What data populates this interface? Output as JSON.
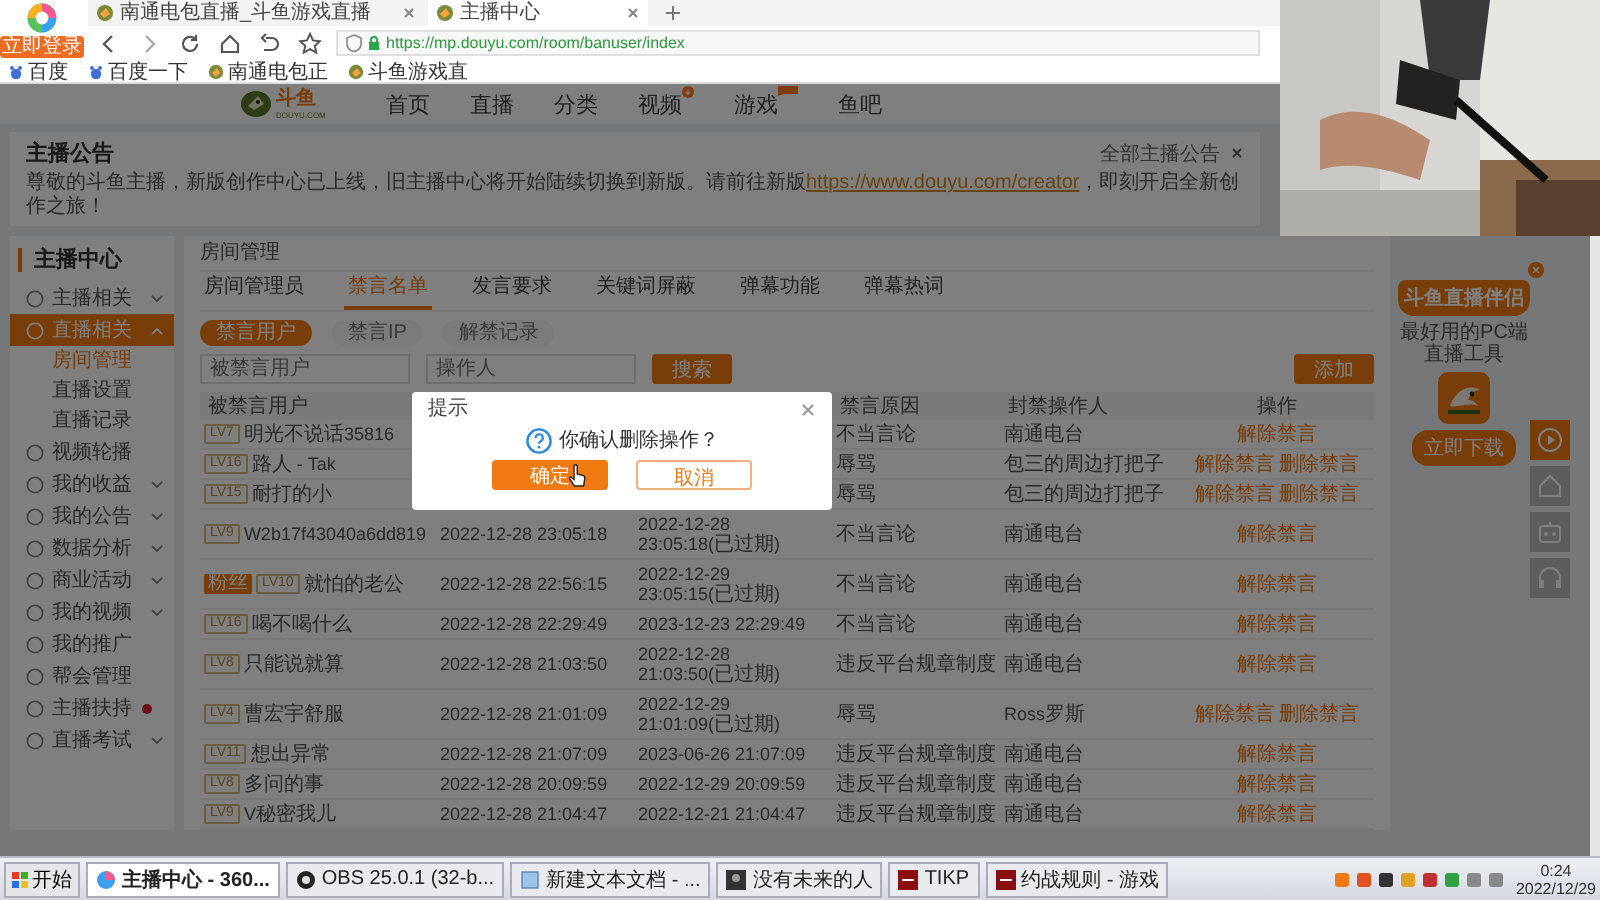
{
  "browser": {
    "login_badge": "立即登录",
    "tabs": [
      {
        "title": "南通电包直播_斗鱼游戏直播",
        "selected": false
      },
      {
        "title": "主播中心",
        "selected": true
      }
    ],
    "address": "https://mp.douyu.com/room/banuser/index",
    "bookmarks": [
      "百度",
      "百度一下",
      "南通电包正",
      "斗鱼游戏直"
    ]
  },
  "site_nav": {
    "logo": "斗鱼",
    "logo_sub": "DOUYU.COM",
    "items": [
      {
        "label": "首页"
      },
      {
        "label": "直播"
      },
      {
        "label": "分类"
      },
      {
        "label": "视频",
        "dot_badge": true
      },
      {
        "label": "游戏",
        "flag_badge": true
      },
      {
        "label": "鱼吧"
      }
    ]
  },
  "announcement": {
    "title": "主播公告",
    "all_link": "全部主播公告",
    "text_before": "尊敬的斗鱼主播，新版创作中心已上线，旧主播中心将开始陆续切换到新版。请前往新版",
    "link": "https://www.douyu.com/creator",
    "text_after": "，即刻开启全新创作之旅！"
  },
  "sidebar": {
    "title": "主播中心",
    "items": [
      {
        "label": "主播相关",
        "expanded": false,
        "selected": false
      },
      {
        "label": "直播相关",
        "expanded": true,
        "selected": true,
        "children": [
          {
            "label": "房间管理",
            "selected": true
          },
          {
            "label": "直播设置",
            "selected": false
          },
          {
            "label": "直播记录",
            "selected": false
          }
        ]
      },
      {
        "label": "视频轮播",
        "selected": false
      },
      {
        "label": "我的收益",
        "expanded": false,
        "selected": false
      },
      {
        "label": "我的公告",
        "expanded": false,
        "selected": false
      },
      {
        "label": "数据分析",
        "expanded": false,
        "selected": false
      },
      {
        "label": "商业活动",
        "expanded": false,
        "selected": false
      },
      {
        "label": "我的视频",
        "expanded": false,
        "selected": false
      },
      {
        "label": "我的推广",
        "selected": false
      },
      {
        "label": "帮会管理",
        "selected": false
      },
      {
        "label": "主播扶持",
        "notice": true,
        "selected": false
      },
      {
        "label": "直播考试",
        "expanded": false,
        "selected": false
      }
    ]
  },
  "main": {
    "title": "房间管理",
    "tabs": [
      {
        "label": "房间管理员",
        "selected": false
      },
      {
        "label": "禁言名单",
        "selected": true
      },
      {
        "label": "发言要求",
        "selected": false
      },
      {
        "label": "关键词屏蔽",
        "selected": false
      },
      {
        "label": "弹幕功能",
        "selected": false
      },
      {
        "label": "弹幕热词",
        "selected": false
      }
    ],
    "subtabs": [
      {
        "label": "禁言用户",
        "selected": true
      },
      {
        "label": "禁言IP",
        "selected": false
      },
      {
        "label": "解禁记录",
        "selected": false
      }
    ],
    "filters": [
      {
        "placeholder": "被禁言用户"
      },
      {
        "placeholder": "操作人"
      }
    ],
    "search_button": "搜索",
    "add_button": "添加",
    "table": {
      "columns": [
        {
          "label": "被禁言用户"
        },
        {},
        {},
        {
          "label": "禁言原因"
        },
        {
          "label": "封禁操作人"
        },
        {
          "label": "操作"
        }
      ],
      "rows": [
        {
          "badges": [
            {
              "kind": "level",
              "text": "LV7"
            }
          ],
          "user": "明光不说话35816",
          "reason": "不当言论",
          "operator": "南通电台",
          "actions": [
            "解除禁言"
          ]
        },
        {
          "badges": [
            {
              "kind": "level",
              "text": "LV16"
            }
          ],
          "user": "路人 - Tak",
          "reason": "辱骂",
          "operator": "包三的周边打把子",
          "actions": [
            "解除禁言",
            "删除禁言"
          ]
        },
        {
          "badges": [
            {
              "kind": "level",
              "text": "LV15"
            }
          ],
          "user": "耐打的小",
          "reason": "辱骂",
          "operator": "包三的周边打把子",
          "actions": [
            "解除禁言",
            "删除禁言"
          ]
        },
        {
          "badges": [
            {
              "kind": "level",
              "text": "LV9"
            }
          ],
          "user": "W2b17f43040a6dd819",
          "time": "2022-12-28 23:05:18",
          "expire": "2022-12-28 23:05:18(已过期)",
          "reason": "不当言论",
          "operator": "南通电台",
          "actions": [
            "解除禁言"
          ]
        },
        {
          "badges": [
            {
              "kind": "fan",
              "text": "粉丝"
            },
            {
              "kind": "level",
              "text": "LV10"
            }
          ],
          "user": "就怕的老公",
          "time": "2022-12-28 22:56:15",
          "expire": "2022-12-29 23:05:15(已过期)",
          "reason": "不当言论",
          "operator": "南通电台",
          "actions": [
            "解除禁言"
          ]
        },
        {
          "badges": [
            {
              "kind": "level",
              "text": "LV16"
            }
          ],
          "user": "喝不喝什么",
          "time": "2022-12-28 22:29:49",
          "expire": "2023-12-23 22:29:49",
          "reason": "不当言论",
          "operator": "南通电台",
          "actions": [
            "解除禁言"
          ]
        },
        {
          "badges": [
            {
              "kind": "level",
              "text": "LV8"
            }
          ],
          "user": "只能说就算",
          "time": "2022-12-28 21:03:50",
          "expire": "2022-12-28 21:03:50(已过期)",
          "reason": "违反平台规章制度",
          "operator": "南通电台",
          "actions": [
            "解除禁言"
          ]
        },
        {
          "badges": [
            {
              "kind": "level",
              "text": "LV4"
            }
          ],
          "user": "曹宏宇舒服",
          "time": "2022-12-28 21:01:09",
          "expire": "2022-12-29 21:01:09(已过期)",
          "reason": "辱骂",
          "operator": "Ross罗斯",
          "actions": [
            "解除禁言",
            "删除禁言"
          ]
        },
        {
          "badges": [
            {
              "kind": "level",
              "text": "LV11"
            }
          ],
          "user": "想出异常",
          "time": "2022-12-28 21:07:09",
          "expire": "2023-06-26 21:07:09",
          "reason": "违反平台规章制度",
          "operator": "南通电台",
          "actions": [
            "解除禁言"
          ]
        },
        {
          "badges": [
            {
              "kind": "level",
              "text": "LV8"
            }
          ],
          "user": "多问的事",
          "time": "2022-12-28 20:09:59",
          "expire": "2022-12-29 20:09:59",
          "reason": "违反平台规章制度",
          "operator": "南通电台",
          "actions": [
            "解除禁言"
          ]
        },
        {
          "badges": [
            {
              "kind": "level",
              "text": "LV9"
            }
          ],
          "user": "V秘密我儿",
          "time": "2022-12-28 21:04:47",
          "expire": "2022-12-21 21:04:47",
          "reason": "违反平台规章制度",
          "operator": "南通电台",
          "actions": [
            "解除禁言"
          ]
        }
      ]
    }
  },
  "dialog": {
    "title": "提示",
    "message": "你确认删除操作？",
    "confirm": "确定",
    "cancel": "取消"
  },
  "promo": {
    "title": "斗鱼直播伴侣",
    "subtitle": "最好用的PC端直播工具",
    "button": "立即下载"
  },
  "taskbar": {
    "start": "开始",
    "items": [
      {
        "label": "主播中心 - 360...",
        "selected": true
      },
      {
        "label": "OBS 25.0.1 (32-b...",
        "selected": false
      },
      {
        "label": "新建文本文档 - ...",
        "selected": false
      },
      {
        "label": "没有未来的人",
        "selected": false
      },
      {
        "label": "TIKP",
        "selected": false
      },
      {
        "label": "约战规则 - 游戏",
        "selected": false
      }
    ],
    "time": "0:24",
    "date": "2022/12/29"
  }
}
